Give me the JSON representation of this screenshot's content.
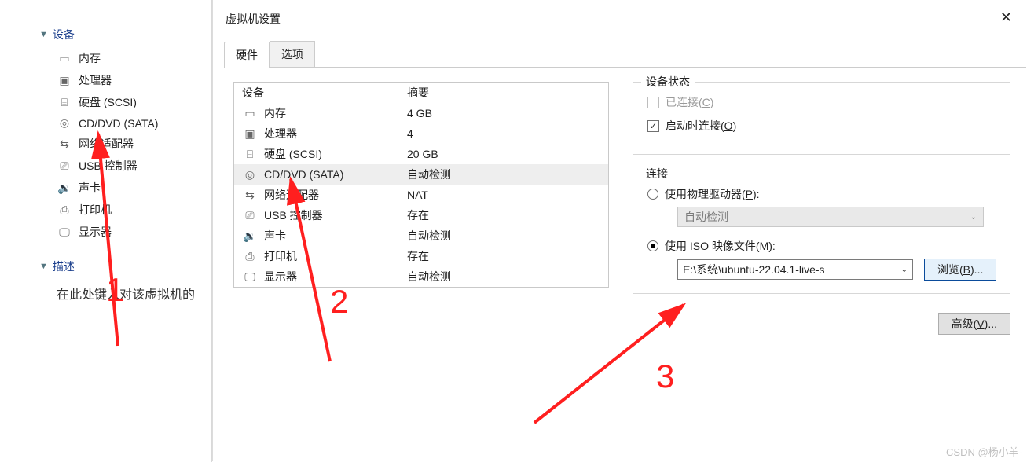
{
  "tree": {
    "devices_header": "设备",
    "items": [
      {
        "icon": "memory-icon",
        "label": "内存"
      },
      {
        "icon": "cpu-icon",
        "label": "处理器"
      },
      {
        "icon": "disk-icon",
        "label": "硬盘 (SCSI)"
      },
      {
        "icon": "disc-icon",
        "label": "CD/DVD (SATA)"
      },
      {
        "icon": "network-icon",
        "label": "网络适配器"
      },
      {
        "icon": "usb-icon",
        "label": "USB 控制器"
      },
      {
        "icon": "audio-icon",
        "label": "声卡"
      },
      {
        "icon": "printer-icon",
        "label": "打印机"
      },
      {
        "icon": "display-icon",
        "label": "显示器"
      }
    ],
    "desc_header": "描述",
    "desc_text": "在此处键入对该虚拟机的"
  },
  "dialog": {
    "title": "虚拟机设置",
    "tabs": {
      "hardware": "硬件",
      "options": "选项"
    },
    "table": {
      "head_device": "设备",
      "head_summary": "摘要",
      "rows": [
        {
          "icon": "memory-icon",
          "dev": "内存",
          "sum": "4 GB",
          "selected": false
        },
        {
          "icon": "cpu-icon",
          "dev": "处理器",
          "sum": "4",
          "selected": false
        },
        {
          "icon": "disk-icon",
          "dev": "硬盘 (SCSI)",
          "sum": "20 GB",
          "selected": false
        },
        {
          "icon": "disc-icon",
          "dev": "CD/DVD (SATA)",
          "sum": "自动检测",
          "selected": true
        },
        {
          "icon": "network-icon",
          "dev": "网络适配器",
          "sum": "NAT",
          "selected": false
        },
        {
          "icon": "usb-icon",
          "dev": "USB 控制器",
          "sum": "存在",
          "selected": false
        },
        {
          "icon": "audio-icon",
          "dev": "声卡",
          "sum": "自动检测",
          "selected": false
        },
        {
          "icon": "printer-icon",
          "dev": "打印机",
          "sum": "存在",
          "selected": false
        },
        {
          "icon": "display-icon",
          "dev": "显示器",
          "sum": "自动检测",
          "selected": false
        }
      ]
    },
    "status": {
      "legend": "设备状态",
      "connected_label": "已连接(C)",
      "connect_on_start_label": "启动时连接(O)"
    },
    "connection": {
      "legend": "连接",
      "physical_label": "使用物理驱动器(P):",
      "physical_value": "自动检测",
      "iso_label": "使用 ISO 映像文件(M):",
      "iso_value": "E:\\系统\\ubuntu-22.04.1-live-s",
      "browse_label": "浏览(B)..."
    },
    "advanced_label": "高级(V)..."
  },
  "annotations": {
    "n1": "1",
    "n2": "2",
    "n3": "3"
  },
  "watermark": "CSDN @杨小羊-"
}
